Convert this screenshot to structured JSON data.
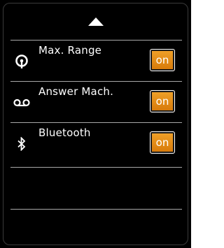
{
  "scroll_up": {
    "icon": "triangle-up-icon"
  },
  "settings": [
    {
      "icon": "range-signal-icon",
      "label": "Max. Range",
      "toggle_label": "on"
    },
    {
      "icon": "voicemail-icon",
      "label": "Answer Mach.",
      "toggle_label": "on"
    },
    {
      "icon": "bluetooth-icon",
      "label": "Bluetooth",
      "toggle_label": "on"
    }
  ],
  "colors": {
    "background": "#000000",
    "text": "#ffffff",
    "divider": "#a8a8a8",
    "toggle_on": "#e88c14"
  }
}
